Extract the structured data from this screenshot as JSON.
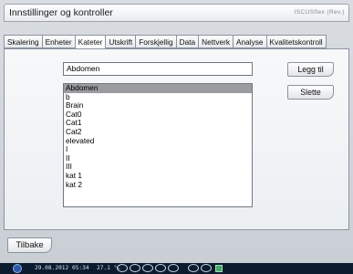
{
  "window": {
    "title": "Innstillinger og kontroller",
    "brand": "ISCUSflex (Rev.)"
  },
  "tabs": [
    {
      "label": "Skalering",
      "active": false
    },
    {
      "label": "Enheter",
      "active": false
    },
    {
      "label": "Kateter",
      "active": true
    },
    {
      "label": "Utskrift",
      "active": false
    },
    {
      "label": "Forskjellig",
      "active": false
    },
    {
      "label": "Data",
      "active": false
    },
    {
      "label": "Nettverk",
      "active": false
    },
    {
      "label": "Analyse",
      "active": false
    },
    {
      "label": "Kvalitetskontroll",
      "active": false
    }
  ],
  "catheter": {
    "name_value": "Abdomen",
    "items": [
      "Abdomen",
      "b",
      "Brain",
      "Cat0",
      "Cat1",
      "Cat2",
      "elevated",
      "I",
      "II",
      "III",
      "kat 1",
      "kat 2"
    ],
    "selected_index": 0,
    "add_label": "Legg til",
    "delete_label": "Slette"
  },
  "back_label": "Tilbake",
  "status": {
    "datetime": "29.08.2012 05:34",
    "temperature": "27.1 °C"
  },
  "colors": {
    "selected_row": "#9a9ca0",
    "status_bar": "#0d1b2e",
    "status_square": "#47a86a"
  }
}
